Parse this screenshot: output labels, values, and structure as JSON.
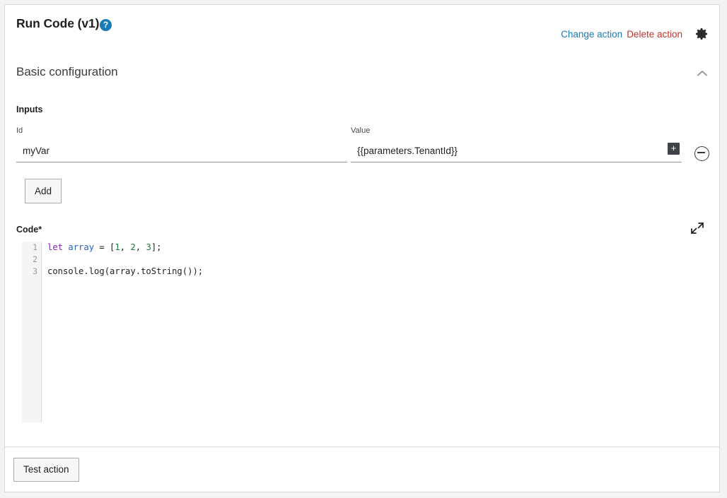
{
  "header": {
    "title": "Run Code (v1)",
    "help_icon": "help-circle-icon",
    "help_glyph": "?",
    "change_action_label": "Change action",
    "delete_action_label": "Delete action",
    "settings_icon": "gear-icon",
    "link_color": "#1b7cb5",
    "delete_color": "#c4342c"
  },
  "section": {
    "title": "Basic configuration",
    "collapse_icon": "chevron-up-icon",
    "expanded": true
  },
  "inputs": {
    "group_label": "Inputs",
    "columns": {
      "id_label": "Id",
      "value_label": "Value"
    },
    "rows": [
      {
        "id_value": "myVar",
        "value_value": "{{parameters.TenantId}}",
        "insert_icon": "plus-icon",
        "insert_glyph": "+",
        "remove_icon": "minus-circle-icon"
      }
    ],
    "add_label": "Add"
  },
  "code": {
    "label": "Code*",
    "expand_icon": "expand-arrows-icon",
    "gutter_numbers": [
      "1",
      "2",
      "3"
    ],
    "lines": [
      {
        "number": "1",
        "tokens": [
          {
            "text": "let",
            "type": "kw"
          },
          {
            "text": " ",
            "type": "plain"
          },
          {
            "text": "array",
            "type": "var"
          },
          {
            "text": " = [",
            "type": "plain"
          },
          {
            "text": "1",
            "type": "num"
          },
          {
            "text": ", ",
            "type": "plain"
          },
          {
            "text": "2",
            "type": "num"
          },
          {
            "text": ", ",
            "type": "plain"
          },
          {
            "text": "3",
            "type": "num"
          },
          {
            "text": "];",
            "type": "plain"
          }
        ],
        "plain_text": "let array = [1, 2, 3];"
      },
      {
        "number": "2",
        "tokens": [],
        "plain_text": ""
      },
      {
        "number": "3",
        "tokens": [
          {
            "text": "console.log(array.toString());",
            "type": "plain"
          }
        ],
        "plain_text": "console.log(array.toString());"
      }
    ]
  },
  "footer": {
    "test_action_label": "Test action"
  }
}
